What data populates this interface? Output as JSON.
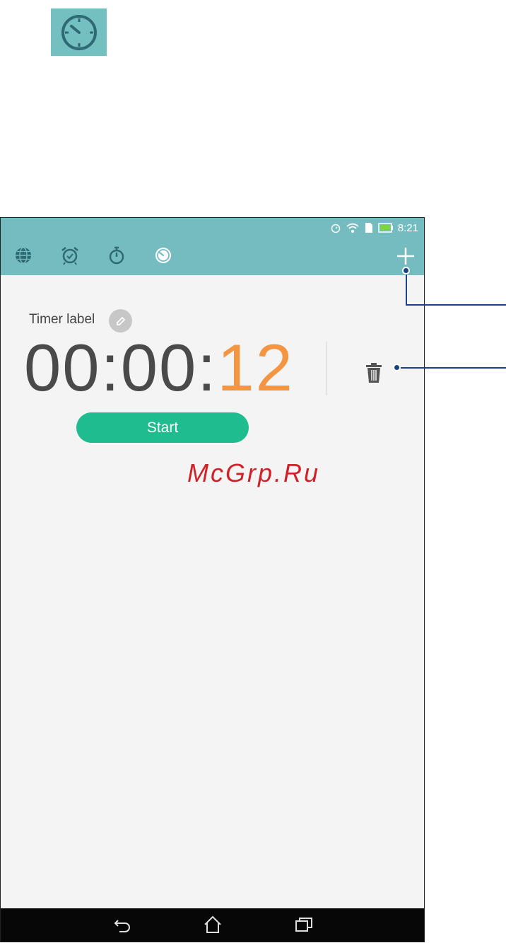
{
  "app_icon": {
    "icon": "stopwatch-icon",
    "background": "#74bfc0"
  },
  "status_bar": {
    "time": "8:21",
    "icons": [
      "alarm-icon",
      "wifi-icon",
      "sim-icon",
      "battery-icon"
    ]
  },
  "toolbar": {
    "tabs": [
      "world-clock-icon",
      "alarm-clock-icon",
      "stopwatch-icon",
      "timer-icon"
    ],
    "add_icon": "plus-icon",
    "color": "#74bcc0"
  },
  "timer": {
    "label": "Timer label",
    "hours": "00",
    "sep1": ":",
    "minutes": "00",
    "sep2": ":",
    "seconds": "12",
    "start_label": "Start",
    "start_color": "#1fbc8f",
    "seconds_color": "#f39543"
  },
  "watermark": "McGrp.Ru",
  "navbar": {
    "buttons": [
      "back-icon",
      "home-icon",
      "recent-apps-icon"
    ]
  }
}
